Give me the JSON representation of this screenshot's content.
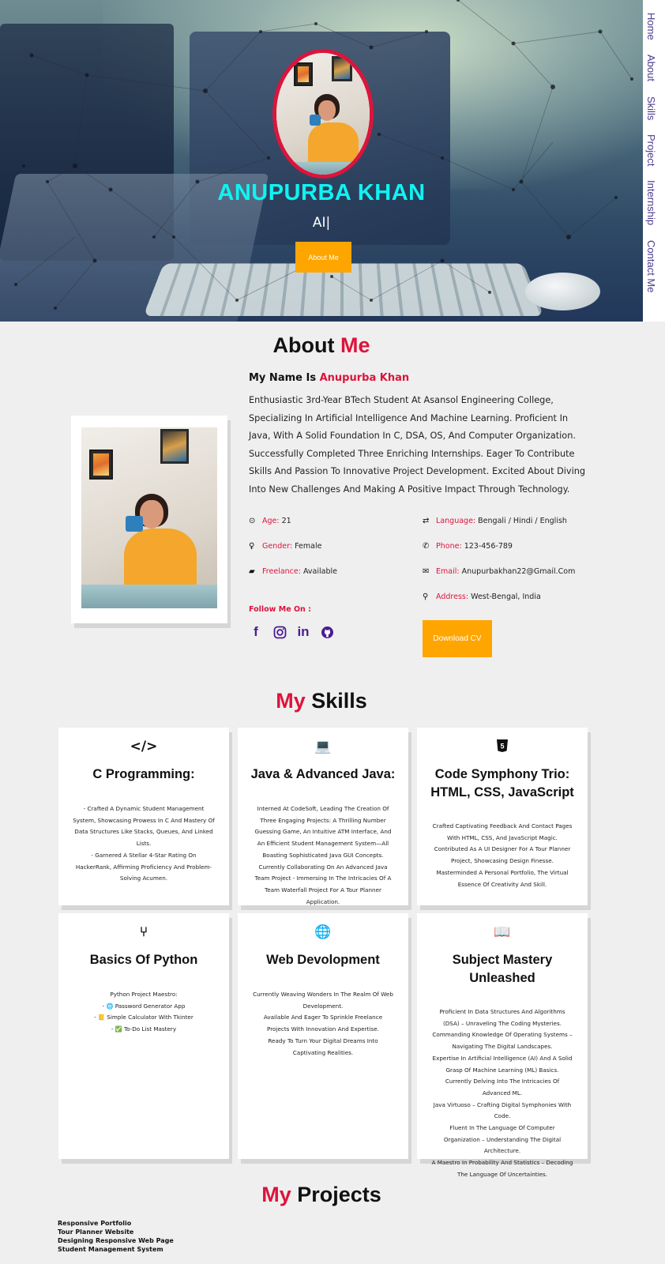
{
  "hero": {
    "name": "ANUPURBA KHAN",
    "role": "AI|",
    "button": "About Me"
  },
  "nav": [
    "Home",
    "About",
    "Skills",
    "Project",
    "Internship",
    "Contact Me"
  ],
  "about": {
    "title_main": "About",
    "title_accent": "Me",
    "name_prefix": "My Name Is",
    "name": "Anupurba Khan",
    "description": "Enthusiastic 3rd-Year BTech Student At Asansol Engineering College, Specializing In Artificial Intelligence And Machine Learning. Proficient In Java, With A Solid Foundation In C, DSA, OS, And Computer Organization. Successfully Completed Three Enriching Internships. Eager To Contribute Skills And Passion To Innovative Project Development. Excited About Diving Into New Challenges And Making A Positive Impact Through Technology.",
    "age_label": "Age:",
    "age": "21",
    "gender_label": "Gender:",
    "gender": "Female",
    "freelance_label": "Freelance:",
    "freelance": "Available",
    "language_label": "Language:",
    "language": "Bengali / Hindi / English",
    "phone_label": "Phone:",
    "phone": "123-456-789",
    "email_label": "Email:",
    "email": "Anupurbakhan22@Gmail.Com",
    "address_label": "Address:",
    "address": "West-Bengal, India",
    "follow": "Follow Me On :",
    "socials": [
      "facebook-icon",
      "instagram-icon",
      "linkedin-icon",
      "github-icon"
    ],
    "cv_button": "Download CV"
  },
  "skills": {
    "title_accent": "My",
    "title_main": "Skills",
    "cards": [
      {
        "icon": "code-icon",
        "title": "C Programming:",
        "lines": [
          "- Crafted A Dynamic Student Management System, Showcasing Prowess In C And Mastery Of Data Structures Like Stacks, Queues, And Linked Lists.",
          "- Garnered A Stellar 4-Star Rating On HackerRank, Affirming Proficiency And Problem-Solving Acumen."
        ]
      },
      {
        "icon": "laptop-icon",
        "title": "Java & Advanced Java:",
        "lines": [
          "Interned At CodeSoft, Leading The Creation Of Three Engaging Projects: A Thrilling Number Guessing Game, An Intuitive ATM Interface, And An Efficient Student Management System—All Boasting Sophisticated Java GUI Concepts. Currently Collaborating On An Advanced Java Team Project - Immersing In The Intricacies Of A Team Waterfall Project For A Tour Planner Application."
        ]
      },
      {
        "icon": "html5-icon",
        "title": "Code Symphony Trio: HTML, CSS, JavaScript",
        "lines": [
          "Crafted Captivating Feedback And Contact Pages With HTML, CSS, And JavaScript Magic.",
          "Contributed As A UI Designer For A Tour Planner Project, Showcasing Design Finesse.",
          "Masterminded A Personal Portfolio, The Virtual Essence Of Creativity And Skill."
        ]
      },
      {
        "icon": "code-branch-icon",
        "title": "Basics Of Python",
        "lines": [
          "Python Project Maestro:",
          "- 🌐 Password Generator App",
          "- 📒 Simple Calculator With Tkinter",
          "- ✅ To-Do List Mastery"
        ]
      },
      {
        "icon": "globe-icon",
        "title": "Web Devolopment",
        "lines": [
          "Currently Weaving Wonders In The Realm Of Web Development.",
          "Available And Eager To Sprinkle Freelance Projects With Innovation And Expertise.",
          "Ready To Turn Your Digital Dreams Into Captivating Realities."
        ]
      },
      {
        "icon": "book-icon",
        "title": "Subject Mastery Unleashed",
        "lines": [
          "Proficient In Data Structures And Algorithms (DSA) – Unraveling The Coding Mysteries.",
          "Commanding Knowledge Of Operating Systems – Navigating The Digital Landscapes.",
          "Expertise In Artificial Intelligence (AI) And A Solid Grasp Of Machine Learning (ML) Basics.",
          "Currently Delving Into The Intricacies Of Advanced ML.",
          "Java Virtuoso – Crafting Digital Symphonies With Code.",
          "Fluent In The Language Of Computer Organization – Understanding The Digital Architecture.",
          "A Maestro In Probability And Statistics – Decoding The Language Of Uncertainties."
        ]
      }
    ]
  },
  "projects": {
    "title_accent": "My",
    "title_main": "Projects",
    "items": [
      "Responsive Portfolio",
      "Tour Planner Website",
      "Designing Responsive Web Page",
      "Student Management System"
    ]
  }
}
